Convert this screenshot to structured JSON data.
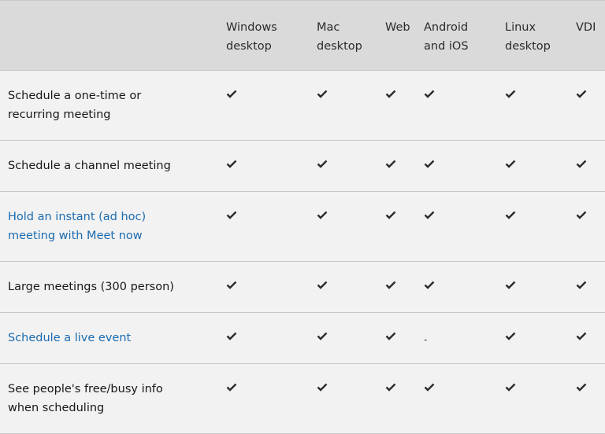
{
  "table": {
    "columns": [
      "",
      "Windows desktop",
      "Mac desktop",
      "Web",
      "Android and iOS",
      "Linux desktop",
      "VDI"
    ],
    "column_lines": [
      [
        "",
        ""
      ],
      [
        "Windows",
        "desktop"
      ],
      [
        "Mac",
        "desktop"
      ],
      [
        "Web",
        ""
      ],
      [
        "Android",
        "and iOS"
      ],
      [
        "Linux",
        "desktop"
      ],
      [
        "VDI",
        ""
      ]
    ],
    "rows": [
      {
        "feature": "Schedule a one-time or recurring meeting",
        "is_link": false,
        "values": [
          "check",
          "check",
          "check",
          "check",
          "check",
          "check"
        ]
      },
      {
        "feature": "Schedule a channel meeting",
        "is_link": false,
        "values": [
          "check",
          "check",
          "check",
          "check",
          "check",
          "check"
        ]
      },
      {
        "feature": "Hold an instant (ad hoc) meeting with Meet now",
        "is_link": true,
        "values": [
          "check",
          "check",
          "check",
          "check",
          "check",
          "check"
        ]
      },
      {
        "feature": "Large meetings (300 person)",
        "is_link": false,
        "values": [
          "check",
          "check",
          "check",
          "check",
          "check",
          "check"
        ]
      },
      {
        "feature": "Schedule a live event",
        "is_link": true,
        "values": [
          "check",
          "check",
          "check",
          "-",
          "check",
          "check"
        ]
      },
      {
        "feature": "See people's free/busy info when scheduling",
        "is_link": false,
        "values": [
          "check",
          "check",
          "check",
          "check",
          "check",
          "check"
        ]
      }
    ],
    "icons": {
      "check": "checkmark-icon",
      "-": "dash"
    },
    "colors": {
      "header_bg": "#dadada",
      "row_bg": "#f2f2f2",
      "link": "#1a6bb0",
      "text": "#171717"
    }
  }
}
